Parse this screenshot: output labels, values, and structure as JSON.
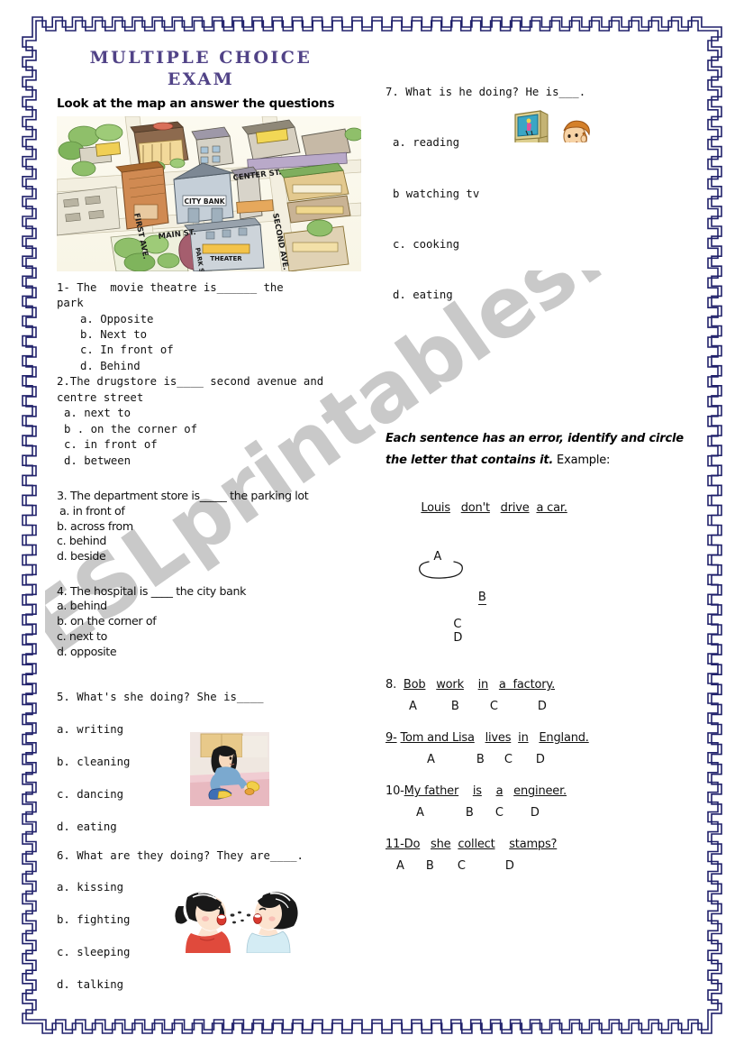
{
  "title": {
    "line1": "MULTIPLE CHOICE",
    "line2": "EXAM"
  },
  "instruction_map": "Look at the map an answer the questions",
  "map": {
    "alt": "street-map-illustration",
    "labels": [
      "FIRST AVE.",
      "MAIN ST.",
      "CENTER ST.",
      "SECOND AVE.",
      "PARK ST.",
      "CITY BANK",
      "THEATER"
    ]
  },
  "watermark": "ESLprintables.com",
  "left_column": {
    "q1": {
      "stem": "1- The  movie theatre is______ the\npark",
      "options": [
        "a. Opposite",
        "b. Next to",
        "c. In front of",
        "d. Behind"
      ]
    },
    "q2": {
      "stem": "2.The drugstore is____ second avenue and\ncentre street",
      "options": [
        "a. next to",
        "b . on the corner of",
        "c. in front of",
        "d. between"
      ]
    },
    "q3": {
      "stem": "3. The department  store is_____ the parking lot",
      "options": [
        "a. in front of",
        "b. across from",
        "c. behind",
        "d. beside"
      ]
    },
    "q4": {
      "stem": "4. The hospital is ____ the city bank",
      "options": [
        "a. behind",
        "b. on the corner of",
        "c. next to",
        "d. opposite"
      ]
    },
    "q5": {
      "stem": "5. What's she doing? She is____",
      "options": [
        "a. writing",
        "b. cleaning",
        "c. dancing",
        "d. eating"
      ],
      "image": "woman-cleaning-kitchen"
    },
    "q6": {
      "stem": "6. What are they  doing? They are____.",
      "options": [
        "a. kissing",
        "b. fighting",
        "c. sleeping",
        "d. talking"
      ],
      "image": "two-children-talking"
    }
  },
  "right_column": {
    "q7": {
      "stem": "7. What is he doing? He is___.",
      "options": [
        "a. reading",
        "b watching tv",
        "c. cooking",
        "d. eating"
      ],
      "image": "boy-watching-tv"
    },
    "error_section": {
      "instruction_bold": "Each sentence has an error, identify and circle the letter that contains it.",
      "instruction_plain": " Example:",
      "example": {
        "words": [
          "Louis",
          "don't",
          "drive",
          "a car."
        ],
        "letters": [
          "A",
          "B",
          "C",
          "D"
        ],
        "circled": "B"
      },
      "items": [
        {
          "number": "8.",
          "words": [
            "Bob",
            "work",
            "in",
            "a  factory."
          ],
          "letters": [
            "A",
            "B",
            "C",
            "D"
          ]
        },
        {
          "number": "9-",
          "words": [
            "Tom and Lisa",
            "lives",
            "in",
            "England."
          ],
          "letters": [
            "A",
            "B",
            "C",
            "D"
          ]
        },
        {
          "number": "10-",
          "words": [
            "My father",
            "is",
            "a",
            "engineer."
          ],
          "letters": [
            "A",
            "B",
            "C",
            "D"
          ]
        },
        {
          "number": "11-",
          "words": [
            "Do",
            "she",
            "collect",
            "stamps?"
          ],
          "letters": [
            "A",
            "B",
            "C",
            "D"
          ]
        }
      ]
    }
  },
  "colors": {
    "border": "#20216b",
    "title": "#514387",
    "watermark": "#c9c9c9",
    "text": "#111111"
  }
}
